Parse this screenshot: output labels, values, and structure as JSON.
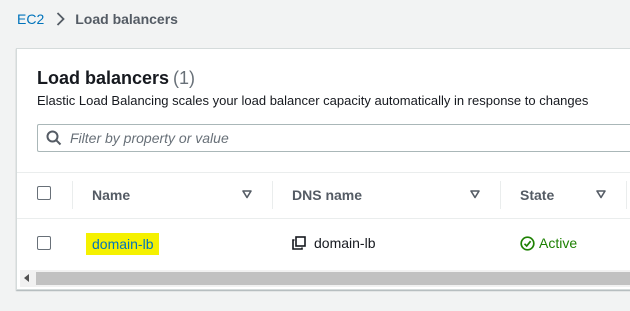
{
  "breadcrumb": {
    "root": "EC2",
    "current": "Load balancers"
  },
  "panel": {
    "title": "Load balancers",
    "count": "(1)",
    "description": "Elastic Load Balancing scales your load balancer capacity automatically in response to changes"
  },
  "filter": {
    "placeholder": "Filter by property or value",
    "value": ""
  },
  "table": {
    "columns": [
      "Name",
      "DNS name",
      "State"
    ],
    "rows": [
      {
        "name": "domain-lb",
        "dns_name": "domain-lb",
        "state": "Active"
      }
    ]
  },
  "colors": {
    "link": "#0073bb",
    "highlight": "#f5f100",
    "active": "#1d8102"
  },
  "icons": [
    "chevron-right-icon",
    "search-icon",
    "sort-caret-icon",
    "copy-icon",
    "status-success-icon"
  ]
}
